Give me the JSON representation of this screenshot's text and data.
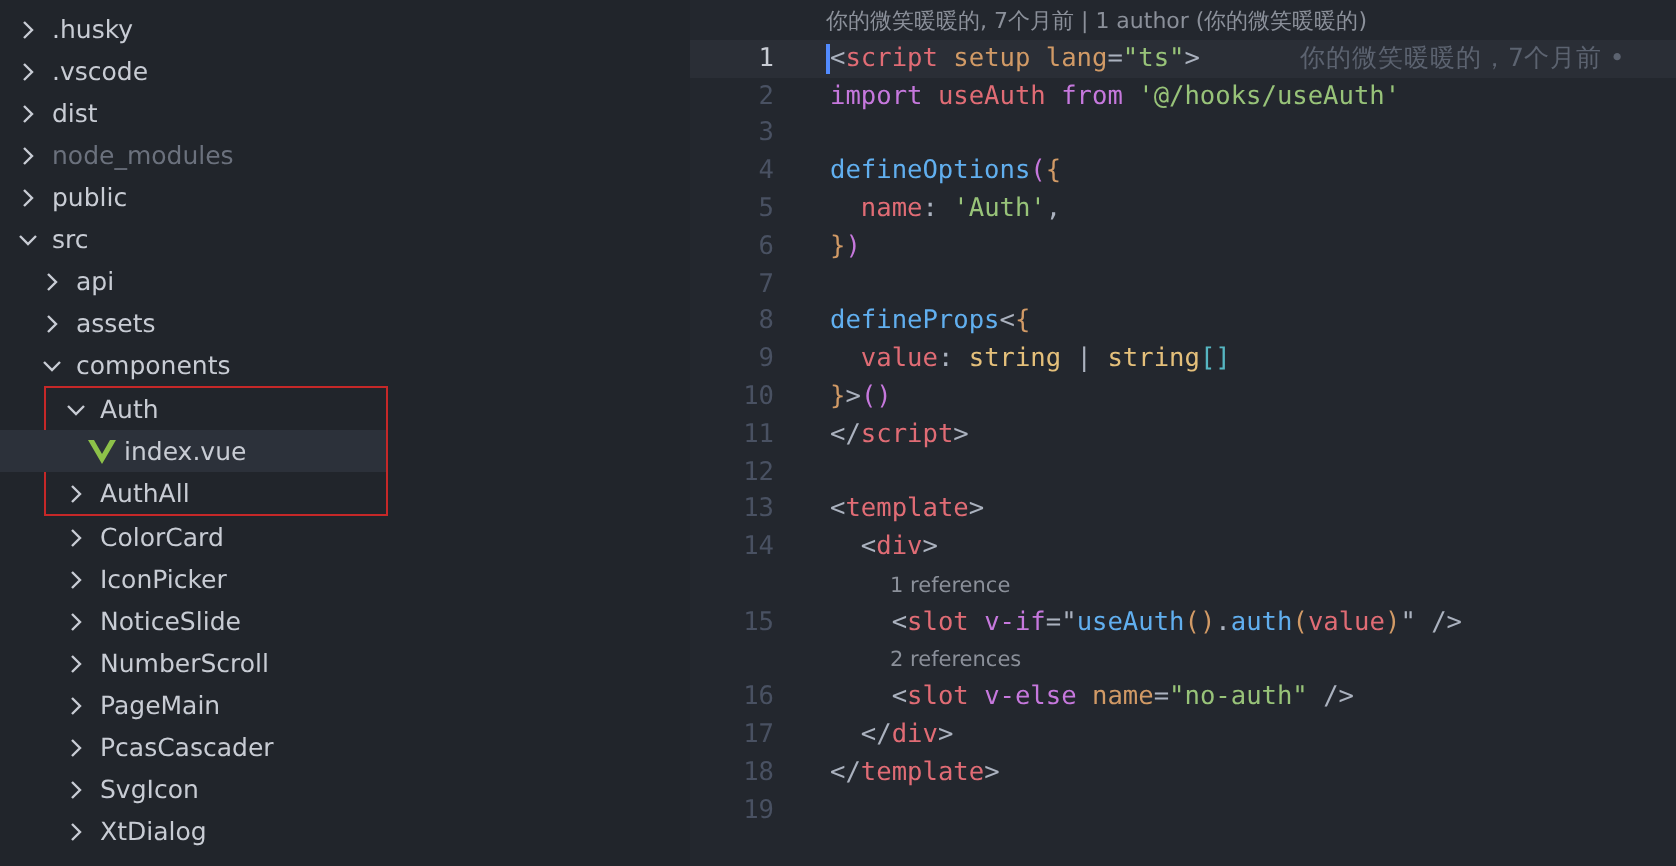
{
  "explorer": {
    "items": [
      {
        "name": ".husky",
        "kind": "folder",
        "expanded": false,
        "ignored": false
      },
      {
        "name": ".vscode",
        "kind": "folder",
        "expanded": false,
        "ignored": false
      },
      {
        "name": "dist",
        "kind": "folder",
        "expanded": false,
        "ignored": false
      },
      {
        "name": "node_modules",
        "kind": "folder",
        "expanded": false,
        "ignored": true
      },
      {
        "name": "public",
        "kind": "folder",
        "expanded": false,
        "ignored": false
      },
      {
        "name": "src",
        "kind": "folder",
        "expanded": true,
        "ignored": false,
        "children": [
          {
            "name": "api",
            "kind": "folder",
            "expanded": false,
            "ignored": false
          },
          {
            "name": "assets",
            "kind": "folder",
            "expanded": false,
            "ignored": false
          },
          {
            "name": "components",
            "kind": "folder",
            "expanded": true,
            "ignored": false,
            "children": [
              {
                "name": "Auth",
                "kind": "folder",
                "expanded": true,
                "ignored": false,
                "outlined": true,
                "children": [
                  {
                    "name": "index.vue",
                    "kind": "vue-file",
                    "selected": true
                  }
                ]
              },
              {
                "name": "AuthAll",
                "kind": "folder",
                "expanded": false,
                "ignored": false,
                "outlined": true
              },
              {
                "name": "ColorCard",
                "kind": "folder",
                "expanded": false,
                "ignored": false,
                "outlined": false
              },
              {
                "name": "IconPicker",
                "kind": "folder",
                "expanded": false,
                "ignored": false,
                "outlined": false
              },
              {
                "name": "NoticeSlide",
                "kind": "folder",
                "expanded": false,
                "ignored": false,
                "outlined": false
              },
              {
                "name": "NumberScroll",
                "kind": "folder",
                "expanded": false,
                "ignored": false,
                "outlined": false
              },
              {
                "name": "PageMain",
                "kind": "folder",
                "expanded": false,
                "ignored": false,
                "outlined": false
              },
              {
                "name": "PcasCascader",
                "kind": "folder",
                "expanded": false,
                "ignored": false,
                "outlined": false
              },
              {
                "name": "SvgIcon",
                "kind": "folder",
                "expanded": false,
                "ignored": false,
                "outlined": false
              },
              {
                "name": "XtDialog",
                "kind": "folder",
                "expanded": false,
                "ignored": false,
                "outlined": false
              }
            ]
          }
        ]
      }
    ]
  },
  "editor": {
    "blame_header": "你的微笑暖暖的, 7个月前 | 1 author (你的微笑暖暖的)",
    "lines": [
      {
        "kind": "code",
        "number": "1",
        "current": true,
        "blame": "你的微笑暖暖的，7个月前 •",
        "tokens": [
          {
            "text": "<",
            "kind": "punct"
          },
          {
            "text": "script",
            "kind": "tag"
          },
          {
            "text": " setup lang",
            "kind": "attr"
          },
          {
            "text": "=",
            "kind": "punct"
          },
          {
            "text": "\"ts\"",
            "kind": "string"
          },
          {
            "text": ">",
            "kind": "punct"
          }
        ]
      },
      {
        "kind": "code",
        "number": "2",
        "current": false,
        "tokens": [
          {
            "text": "import ",
            "kind": "keyword"
          },
          {
            "text": "useAuth ",
            "kind": "variable"
          },
          {
            "text": "from ",
            "kind": "keyword"
          },
          {
            "text": "'@/hooks/useAuth'",
            "kind": "string"
          }
        ]
      },
      {
        "kind": "code",
        "number": "3",
        "current": false
      },
      {
        "kind": "code",
        "number": "4",
        "current": false,
        "tokens": [
          {
            "text": "defineOptions",
            "kind": "function"
          },
          {
            "text": "(",
            "kind": "bracket"
          },
          {
            "text": "{",
            "kind": "bracket2"
          }
        ]
      },
      {
        "kind": "code",
        "number": "5",
        "current": false,
        "tokens": [
          {
            "text": "  name",
            "kind": "variable"
          },
          {
            "text": ": ",
            "kind": "punct"
          },
          {
            "text": "'Auth'",
            "kind": "string"
          },
          {
            "text": ",",
            "kind": "punct"
          }
        ]
      },
      {
        "kind": "code",
        "number": "6",
        "current": false,
        "tokens": [
          {
            "text": "}",
            "kind": "bracket2"
          },
          {
            "text": ")",
            "kind": "bracket"
          }
        ]
      },
      {
        "kind": "code",
        "number": "7",
        "current": false
      },
      {
        "kind": "code",
        "number": "8",
        "current": false,
        "tokens": [
          {
            "text": "defineProps",
            "kind": "function"
          },
          {
            "text": "<",
            "kind": "punct"
          },
          {
            "text": "{",
            "kind": "bracket2"
          }
        ]
      },
      {
        "kind": "code",
        "number": "9",
        "current": false,
        "tokens": [
          {
            "text": "  value",
            "kind": "variable"
          },
          {
            "text": ": ",
            "kind": "punct"
          },
          {
            "text": "string ",
            "kind": "type"
          },
          {
            "text": "| ",
            "kind": "punct"
          },
          {
            "text": "string",
            "kind": "type"
          },
          {
            "text": "[]",
            "kind": "bracket3"
          }
        ]
      },
      {
        "kind": "code",
        "number": "10",
        "current": false,
        "tokens": [
          {
            "text": "}",
            "kind": "bracket2"
          },
          {
            "text": ">",
            "kind": "punct"
          },
          {
            "text": "()",
            "kind": "bracket"
          }
        ]
      },
      {
        "kind": "code",
        "number": "11",
        "current": false,
        "tokens": [
          {
            "text": "</",
            "kind": "punct"
          },
          {
            "text": "script",
            "kind": "tag"
          },
          {
            "text": ">",
            "kind": "punct"
          }
        ]
      },
      {
        "kind": "code",
        "number": "12",
        "current": false
      },
      {
        "kind": "code",
        "number": "13",
        "current": false,
        "tokens": [
          {
            "text": "<",
            "kind": "punct"
          },
          {
            "text": "template",
            "kind": "tag"
          },
          {
            "text": ">",
            "kind": "punct"
          }
        ]
      },
      {
        "kind": "code",
        "number": "14",
        "current": false,
        "tokens": [
          {
            "text": "  <",
            "kind": "punct"
          },
          {
            "text": "div",
            "kind": "tag"
          },
          {
            "text": ">",
            "kind": "punct"
          }
        ]
      },
      {
        "kind": "codelens",
        "text": "1 reference"
      },
      {
        "kind": "code",
        "number": "15",
        "current": false,
        "tokens": [
          {
            "text": "    <",
            "kind": "punct"
          },
          {
            "text": "slot ",
            "kind": "tag"
          },
          {
            "text": "v-if",
            "kind": "keyword"
          },
          {
            "text": "=\"",
            "kind": "punct"
          },
          {
            "text": "useAuth",
            "kind": "function"
          },
          {
            "text": "()",
            "kind": "bracket2"
          },
          {
            "text": ".",
            "kind": "punct"
          },
          {
            "text": "auth",
            "kind": "function"
          },
          {
            "text": "(",
            "kind": "bracket2"
          },
          {
            "text": "value",
            "kind": "variable"
          },
          {
            "text": ")",
            "kind": "bracket2"
          },
          {
            "text": "\" />",
            "kind": "punct"
          }
        ]
      },
      {
        "kind": "codelens",
        "text": "2 references"
      },
      {
        "kind": "code",
        "number": "16",
        "current": false,
        "tokens": [
          {
            "text": "    <",
            "kind": "punct"
          },
          {
            "text": "slot ",
            "kind": "tag"
          },
          {
            "text": "v-else ",
            "kind": "keyword"
          },
          {
            "text": "name",
            "kind": "attr"
          },
          {
            "text": "=",
            "kind": "punct"
          },
          {
            "text": "\"no-auth\"",
            "kind": "string"
          },
          {
            "text": " />",
            "kind": "punct"
          }
        ]
      },
      {
        "kind": "code",
        "number": "17",
        "current": false,
        "tokens": [
          {
            "text": "  </",
            "kind": "punct"
          },
          {
            "text": "div",
            "kind": "tag"
          },
          {
            "text": ">",
            "kind": "punct"
          }
        ]
      },
      {
        "kind": "code",
        "number": "18",
        "current": false,
        "tokens": [
          {
            "text": "</",
            "kind": "punct"
          },
          {
            "text": "template",
            "kind": "tag"
          },
          {
            "text": ">",
            "kind": "punct"
          }
        ]
      },
      {
        "kind": "code",
        "number": "19",
        "current": false
      }
    ]
  }
}
